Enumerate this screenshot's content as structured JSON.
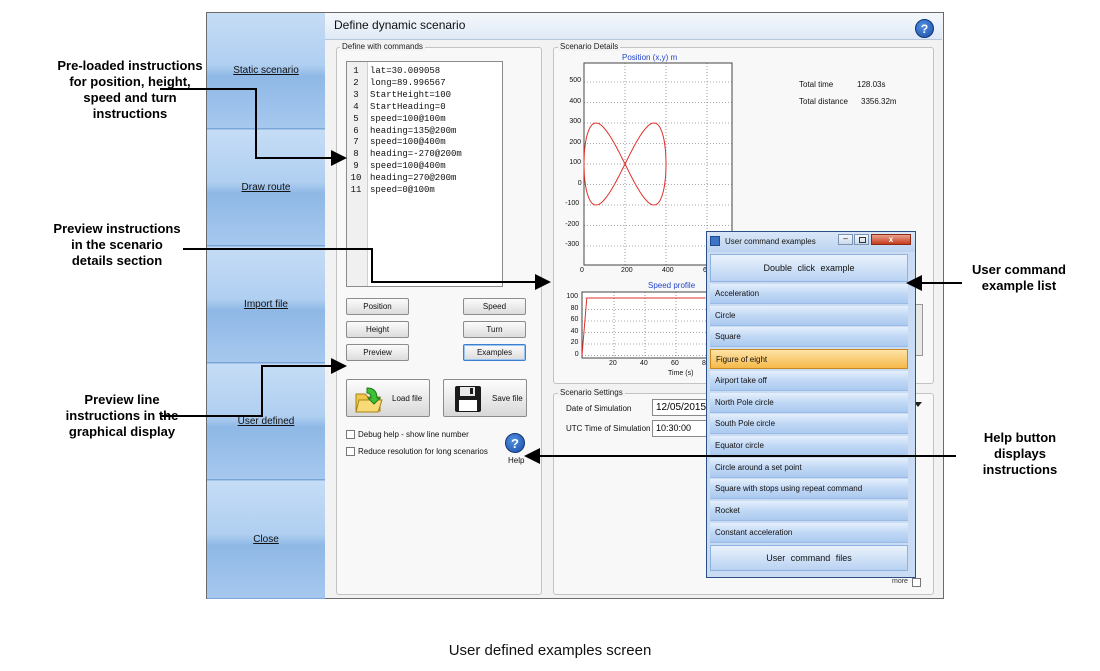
{
  "window": {
    "title": "Define dynamic scenario",
    "sidebar": [
      "Static scenario",
      "Draw route",
      "Import file",
      "User defined",
      "Close"
    ]
  },
  "commands": {
    "group_label": "Define with commands",
    "lines": [
      "lat=30.009058",
      "long=89.996567",
      "StartHeight=100",
      "StartHeading=0",
      "speed=100@100m",
      "heading=135@200m",
      "speed=100@400m",
      "heading=-270@200m",
      "speed=100@400m",
      "heading=270@200m",
      "speed=0@100m"
    ],
    "buttons": {
      "position": "Position",
      "speed": "Speed",
      "height": "Height",
      "turn": "Turn",
      "preview": "Preview",
      "examples": "Examples"
    },
    "load_file": "Load file",
    "save_file": "Save file",
    "debug_help": "Debug help - show line number",
    "reduce_resolution": "Reduce resolution for long scenarios",
    "help_label": "Help"
  },
  "details": {
    "group_label": "Scenario Details",
    "total_time_label": "Total time",
    "total_time_value": "128.03s",
    "total_distance_label": "Total distance",
    "total_distance_value": "3356.32m",
    "more_label": "more"
  },
  "settings": {
    "group_label": "Scenario Settings",
    "date_label": "Date of Simulation",
    "date_value": "12/05/2015",
    "utc_label": "UTC Time of Simulation",
    "utc_value": "10:30:00"
  },
  "chart_data": [
    {
      "type": "line",
      "title": "Position (x,y) m",
      "yticks": [
        "500",
        "400",
        "300",
        "200",
        "100",
        "0",
        "-100",
        "-200",
        "-300"
      ],
      "xticks": [
        "0",
        "200",
        "400",
        "6"
      ],
      "series": [
        {
          "color": "#e0302a",
          "shape": "figure-of-eight",
          "x_range": [
            0,
            400
          ],
          "y_range": [
            -100,
            300
          ]
        }
      ]
    },
    {
      "type": "line",
      "title": "Speed profile",
      "xlabel": "Time (s)",
      "yticks": [
        "100",
        "80",
        "60",
        "40",
        "20",
        "0"
      ],
      "xticks": [
        "20",
        "40",
        "60",
        "8"
      ],
      "series": [
        {
          "color": "#e0302a",
          "x": [
            0,
            5,
            128
          ],
          "y": [
            0,
            100,
            100
          ]
        }
      ]
    }
  ],
  "popup": {
    "title": "User command examples",
    "header": "Double click example",
    "items": [
      "Acceleration",
      "Circle",
      "Square",
      "Figure of eight",
      "Airport take off",
      "North Pole circle",
      "South Pole circle",
      "Equator circle",
      "Circle around a set point",
      "Square with stops using repeat command",
      "Rocket",
      "Constant acceleration"
    ],
    "selected_index": 3,
    "footer": "User command files"
  },
  "annotations": {
    "preloaded": "Pre-loaded instructions for position, height, speed and turn instructions",
    "preview": "Preview instructions in the scenario details section",
    "preview_line": "Preview line instructions in the graphical display",
    "example_list": "User command example list",
    "help_button": "Help button displays instructions"
  },
  "caption": "User defined examples screen",
  "colors": {
    "accent": "#9fc3ea",
    "plot_line": "#e0302a",
    "selected": "#f6b94a"
  }
}
